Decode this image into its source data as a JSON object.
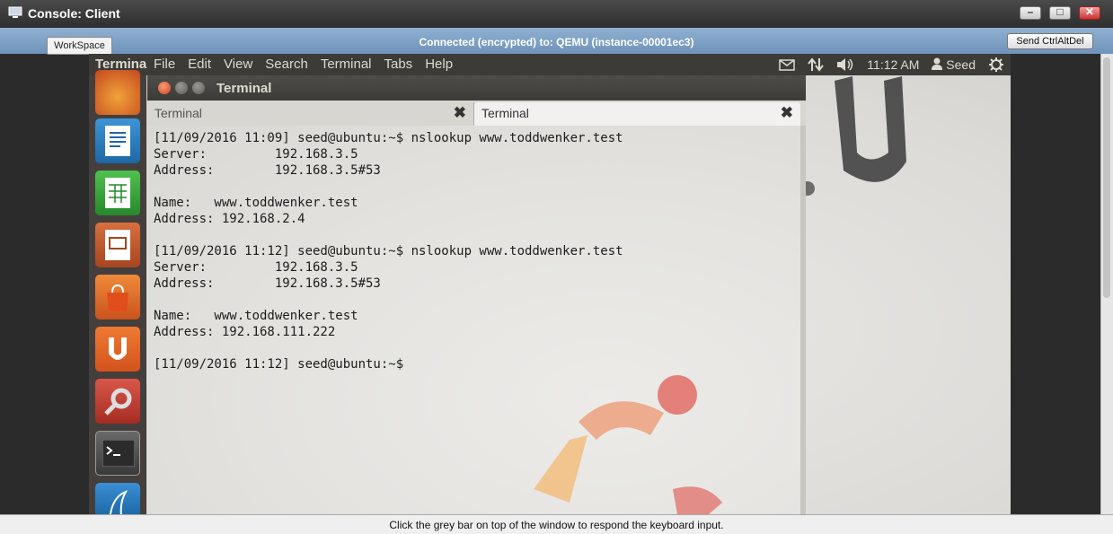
{
  "window": {
    "title": "Console: Client",
    "controls": {
      "minimize": "–",
      "restore": "□",
      "close": "✕"
    }
  },
  "connection": {
    "text": "Connected (encrypted) to: QEMU (instance-00001ec3)",
    "workspace_label": "WorkSpace",
    "send_cad_label": "Send CtrlAltDel"
  },
  "panel": {
    "app_name": "Termina",
    "menu": [
      "File",
      "Edit",
      "View",
      "Search",
      "Terminal",
      "Tabs",
      "Help"
    ],
    "clock": "11:12 AM",
    "user": "Seed"
  },
  "launcher": {
    "items": [
      {
        "name": "firefox",
        "color": "#d9622b"
      },
      {
        "name": "writer",
        "color": "#2a7fc1"
      },
      {
        "name": "calc",
        "color": "#3aa33a"
      },
      {
        "name": "impress",
        "color": "#c0582f"
      },
      {
        "name": "software-center",
        "color": "#e0662a"
      },
      {
        "name": "ubuntu-one",
        "color": "#e46420"
      },
      {
        "name": "system-settings",
        "color": "#c9402f"
      },
      {
        "name": "terminal",
        "color": "#4a4a4a"
      },
      {
        "name": "wireshark",
        "color": "#1c6fb0"
      }
    ]
  },
  "terminal": {
    "window_title": "Terminal",
    "tabs": [
      {
        "label": "Terminal",
        "active": false
      },
      {
        "label": "Terminal",
        "active": true
      }
    ],
    "lines": [
      "[11/09/2016 11:09] seed@ubuntu:~$ nslookup www.toddwenker.test",
      "Server:         192.168.3.5",
      "Address:        192.168.3.5#53",
      "",
      "Name:   www.toddwenker.test",
      "Address: 192.168.2.4",
      "",
      "[11/09/2016 11:12] seed@ubuntu:~$ nslookup www.toddwenker.test",
      "Server:         192.168.3.5",
      "Address:        192.168.3.5#53",
      "",
      "Name:   www.toddwenker.test",
      "Address: 192.168.111.222",
      "",
      "[11/09/2016 11:12] seed@ubuntu:~$ "
    ]
  },
  "status": {
    "text": "Click the grey bar on top of the window to respond the keyboard input."
  }
}
